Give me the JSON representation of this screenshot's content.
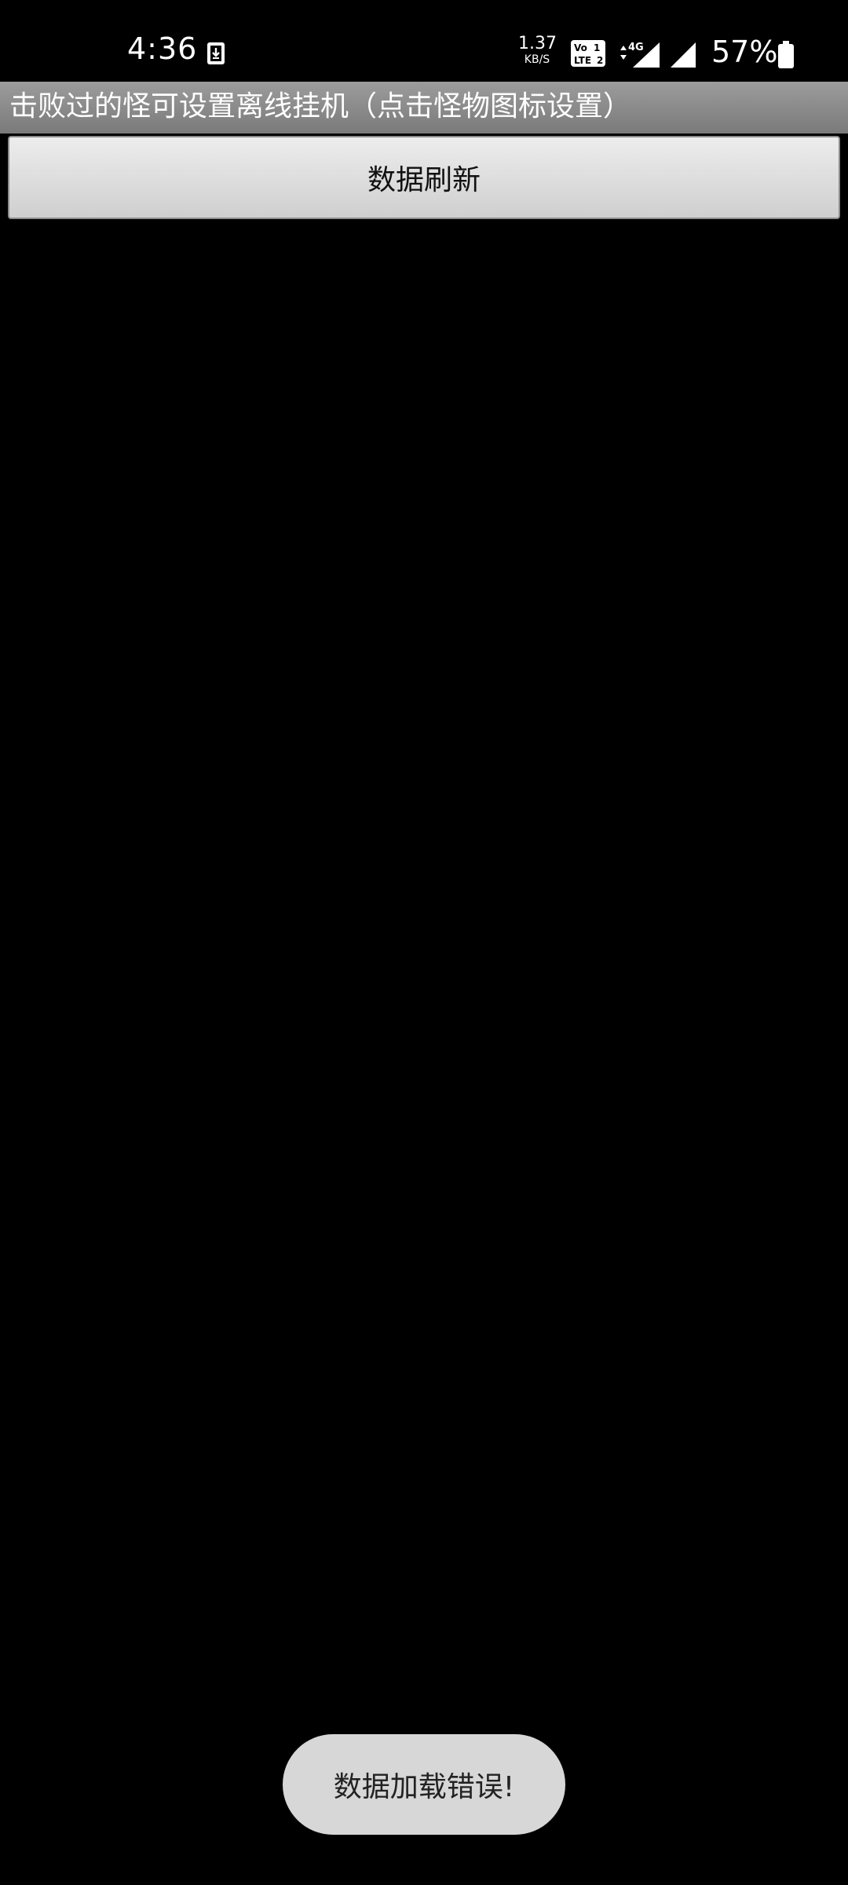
{
  "status_bar": {
    "time": "4:36",
    "net_speed_value": "1.37",
    "net_speed_unit": "KB/S",
    "network_type": "4G",
    "battery_percent": "57%",
    "icons": [
      "download-notification-icon",
      "volte-lte2-icon",
      "signal-4g-icon",
      "signal-icon",
      "battery-icon"
    ]
  },
  "title_bar": {
    "title": "击败过的怪可设置离线挂机（点击怪物图标设置）"
  },
  "main": {
    "refresh_button_label": "数据刷新"
  },
  "toast": {
    "message": "数据加载错误!"
  },
  "colors": {
    "background": "#000000",
    "title_bar": "#8a8a8a",
    "button": "#dcdcdc",
    "toast": "#d7d7d7"
  }
}
